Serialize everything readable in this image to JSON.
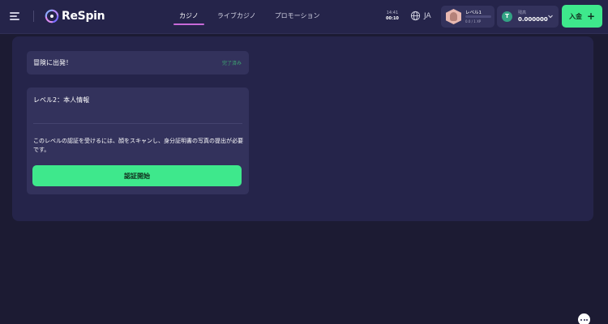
{
  "header": {
    "logo_text": "ReSpin",
    "nav_tabs": [
      {
        "label": "カジノ",
        "active": true
      },
      {
        "label": "ライブカジノ",
        "active": false
      },
      {
        "label": "プロモーション",
        "active": false
      }
    ],
    "clock": {
      "line1": "14:41",
      "line2": "00:10"
    },
    "language": "JA",
    "level": {
      "label": "レベル1",
      "xp": "0.0 / 1 XP",
      "progress": 0
    },
    "wallet": {
      "coin_symbol": "T",
      "label": "残高",
      "balance": "0.000000"
    },
    "deposit_label": "入金",
    "deposit_plus": "+"
  },
  "main": {
    "adventure_card": {
      "title": "冒険に出発！",
      "status": "完了済み"
    },
    "level2_card": {
      "title": "レベル2：本人情報",
      "description": "このレベルの認証を受けるには、顔をスキャンし、身分証明書の写真の提出が必要です。",
      "button_label": "認証開始"
    }
  },
  "colors": {
    "background": "#1c1b33",
    "panel": "#25244a",
    "card": "#33325c",
    "accent_green": "#3ee88c",
    "tab_underline": "#c86ad8",
    "status_green": "#3ea872"
  },
  "icons": [
    "menu-icon",
    "respin-logo-icon",
    "globe-icon",
    "tether-coin-icon",
    "chevron-down-icon",
    "plus-icon",
    "chat-icon"
  ]
}
